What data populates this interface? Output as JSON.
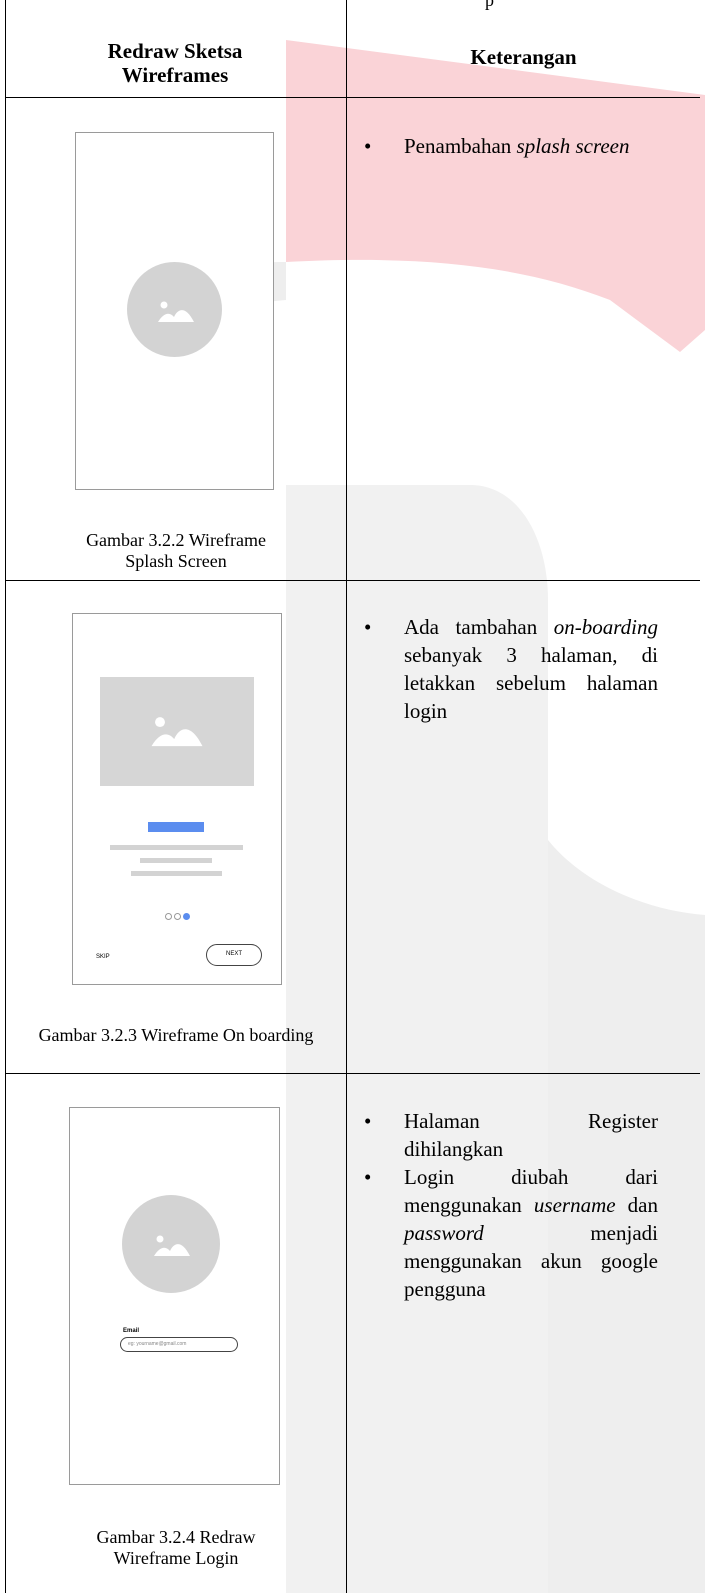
{
  "header": {
    "col1": "Redraw Sketsa Wireframes",
    "col2": "Keterangan",
    "top_fragment": "p"
  },
  "rows": [
    {
      "caption": "Gambar 3.2.2 Wireframe Splash Screen",
      "notes": [
        {
          "parts": [
            {
              "t": "Penambahan ",
              "i": false
            },
            {
              "t": "splash screen",
              "i": true
            }
          ]
        }
      ]
    },
    {
      "caption": "Gambar 3.2.3 Wireframe On boarding",
      "notes": [
        {
          "parts": [
            {
              "t": "Ada tambahan ",
              "i": false
            },
            {
              "t": "on-boarding",
              "i": true
            },
            {
              "t": " sebanyak 3 halaman, di letakkan sebelum halaman login",
              "i": false
            }
          ]
        }
      ],
      "wireframe": {
        "skip_label": "SKIP",
        "next_label": "NEXT",
        "dots": [
          "empty",
          "empty",
          "filled"
        ],
        "accent": "#5b8def"
      }
    },
    {
      "caption": "Gambar 3.2.4 Redraw Wireframe Login",
      "notes": [
        {
          "parts": [
            {
              "t": "Halaman Register dihilangkan",
              "i": false
            }
          ]
        },
        {
          "parts": [
            {
              "t": "Login diubah dari menggunakan ",
              "i": false
            },
            {
              "t": "username",
              "i": true
            },
            {
              "t": " dan ",
              "i": false
            },
            {
              "t": "password",
              "i": true
            },
            {
              "t": " menjadi menggunakan akun google pengguna",
              "i": false
            }
          ]
        }
      ],
      "wireframe": {
        "email_label": "Email",
        "email_placeholder": "eg: yourname@gmail.com"
      }
    }
  ],
  "watermark_colors": {
    "red": "#fad3d7",
    "grey": "#eeeeee"
  }
}
